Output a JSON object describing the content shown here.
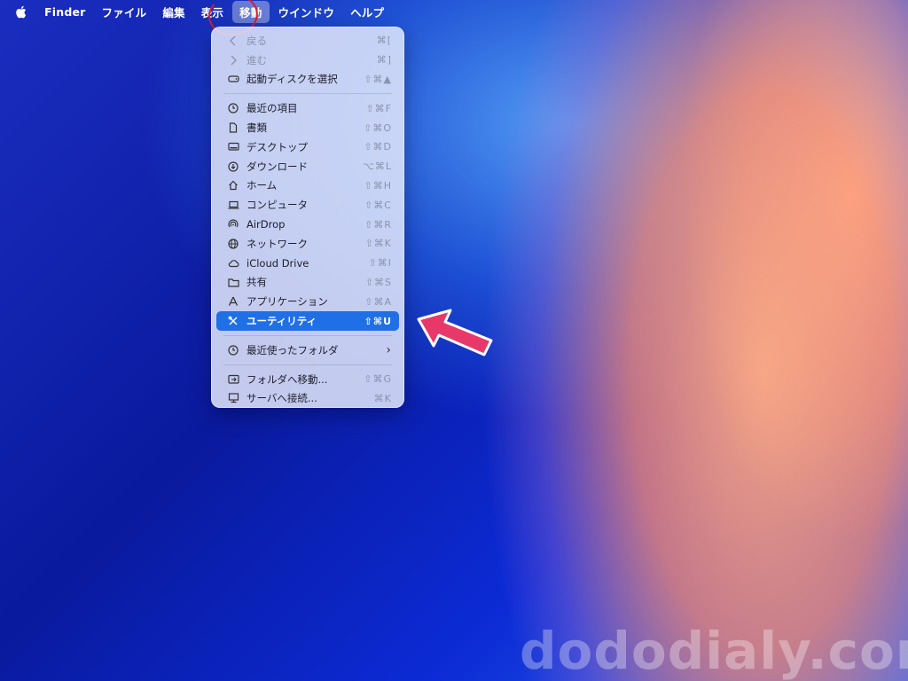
{
  "menubar": {
    "items": [
      "Finder",
      "ファイル",
      "編集",
      "表示",
      "移動",
      "ウインドウ",
      "ヘルプ"
    ],
    "active_index": 4
  },
  "menu": {
    "items": [
      {
        "label": "戻る",
        "shortcut": "⌘[",
        "icon": "chevron-left-icon",
        "disabled": true
      },
      {
        "label": "進む",
        "shortcut": "⌘]",
        "icon": "chevron-right-icon",
        "disabled": true
      },
      {
        "label": "起動ディスクを選択",
        "shortcut": "⇧⌘▲",
        "icon": "disk-icon"
      },
      {
        "label": "最近の項目",
        "shortcut": "⇧⌘F",
        "icon": "clock-icon"
      },
      {
        "label": "書類",
        "shortcut": "⇧⌘O",
        "icon": "document-icon"
      },
      {
        "label": "デスクトップ",
        "shortcut": "⇧⌘D",
        "icon": "desktop-icon"
      },
      {
        "label": "ダウンロード",
        "shortcut": "⌥⌘L",
        "icon": "download-icon"
      },
      {
        "label": "ホーム",
        "shortcut": "⇧⌘H",
        "icon": "home-icon"
      },
      {
        "label": "コンピュータ",
        "shortcut": "⇧⌘C",
        "icon": "laptop-icon"
      },
      {
        "label": "AirDrop",
        "shortcut": "⇧⌘R",
        "icon": "airdrop-icon"
      },
      {
        "label": "ネットワーク",
        "shortcut": "⇧⌘K",
        "icon": "globe-icon"
      },
      {
        "label": "iCloud Drive",
        "shortcut": "⇧⌘I",
        "icon": "cloud-icon"
      },
      {
        "label": "共有",
        "shortcut": "⇧⌘S",
        "icon": "shared-folder-icon"
      },
      {
        "label": "アプリケーション",
        "shortcut": "⇧⌘A",
        "icon": "applications-icon"
      },
      {
        "label": "ユーティリティ",
        "shortcut": "⇧⌘U",
        "icon": "tools-icon",
        "highlighted": true
      },
      {
        "label": "最近使ったフォルダ",
        "shortcut": "›",
        "icon": "clock-icon"
      },
      {
        "label": "フォルダへ移動...",
        "shortcut": "⇧⌘G",
        "icon": "folder-go-icon"
      },
      {
        "label": "サーバへ接続...",
        "shortcut": "⌘K",
        "icon": "server-icon"
      }
    ]
  },
  "watermark": "dododialy.com",
  "colors": {
    "highlight": "#1f6fe6",
    "annotation": "#e8386a"
  }
}
